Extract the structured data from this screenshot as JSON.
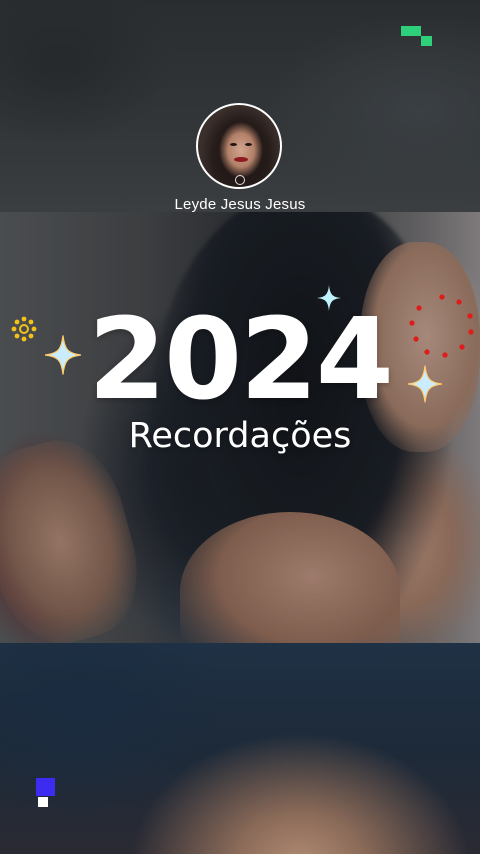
{
  "profile": {
    "name": "Leyde Jesus Jesus"
  },
  "headline": {
    "year": "2024",
    "subtitle": "Recordações"
  },
  "icons": {
    "top_right_logo": "green-block-logo-icon",
    "bottom_left_logo": "blue-white-block-logo-icon",
    "sparkles": "sparkle-icon",
    "yellow_ring": "yellow-dotted-ring-icon",
    "red_ring": "red-dotted-ring-icon"
  },
  "colors": {
    "text": "#ffffff",
    "logo_green": "#2fd07b",
    "logo_blue": "#3b2cf0",
    "ring_red": "#e01b1b",
    "ring_yellow": "#f2c21a"
  }
}
